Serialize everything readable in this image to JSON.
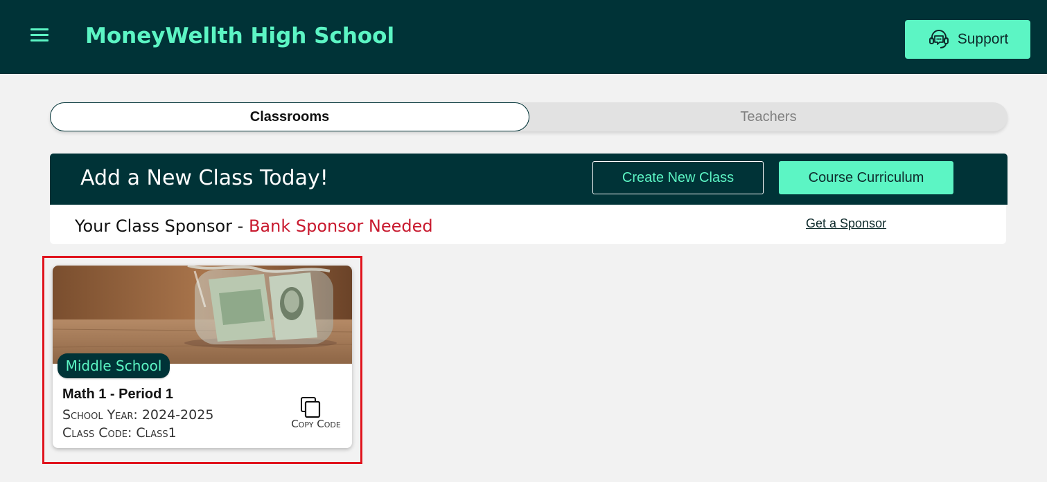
{
  "header": {
    "title": "MoneyWellth High School",
    "support_label": "Support"
  },
  "tabs": [
    {
      "label": "Classrooms",
      "active": true
    },
    {
      "label": "Teachers",
      "active": false
    }
  ],
  "banner": {
    "title": "Add a New Class Today!",
    "create_label": "Create New Class",
    "curriculum_label": "Course Curriculum"
  },
  "sponsor": {
    "prefix": "Your Class Sponsor - ",
    "status": "Bank Sponsor Needed",
    "link_label": "Get a Sponsor"
  },
  "classes": [
    {
      "level": "Middle School",
      "name": "Math 1 - Period 1",
      "school_year": "School Year: 2024-2025",
      "class_code": "Class Code: Class1",
      "copy_label": "Copy Code"
    }
  ],
  "icons": {
    "menu": "hamburger-menu-icon",
    "support": "headset-chat-icon",
    "copy": "copy-icon"
  },
  "colors": {
    "brand_dark": "#003337",
    "accent": "#5cf5c4",
    "alert": "#c8192e",
    "highlight": "#e0141e"
  }
}
